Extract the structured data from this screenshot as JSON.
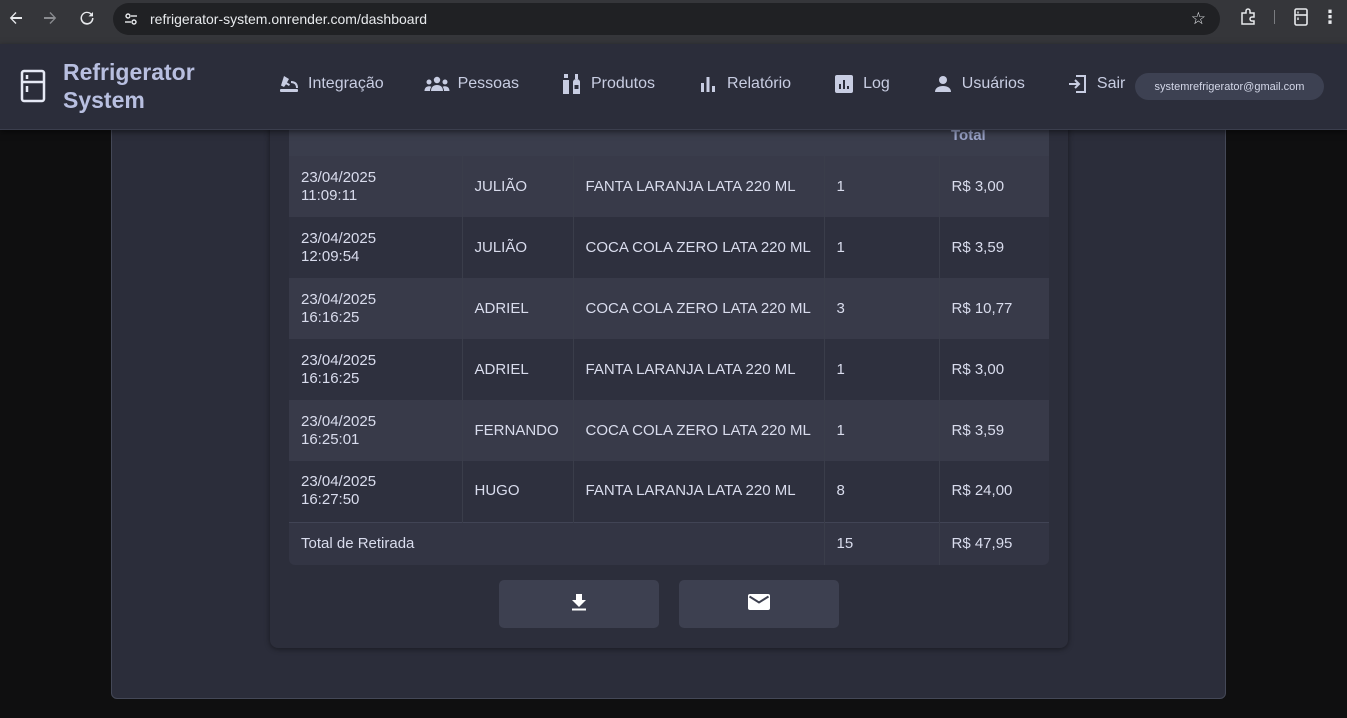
{
  "browser": {
    "url": "refrigerator-system.onrender.com/dashboard"
  },
  "app": {
    "title": "Refrigerator System",
    "user_email": "systemrefrigerator@gmail.com"
  },
  "nav": [
    {
      "label": "Integração",
      "icon": "integration-icon"
    },
    {
      "label": "Pessoas",
      "icon": "people-icon"
    },
    {
      "label": "Produtos",
      "icon": "bottles-icon"
    },
    {
      "label": "Relatório",
      "icon": "bar-chart-icon"
    },
    {
      "label": "Log",
      "icon": "analytics-icon"
    },
    {
      "label": "Usuários",
      "icon": "user-icon"
    },
    {
      "label": "Sair",
      "icon": "logout-icon"
    }
  ],
  "table": {
    "headers": [
      "",
      "",
      "",
      "",
      "Total"
    ],
    "rows": [
      {
        "date": "23/04/2025",
        "time": "11:09:11",
        "person": "JULIÃO",
        "product": "FANTA LARANJA LATA 220 ML",
        "qty": "1",
        "total": "R$ 3,00"
      },
      {
        "date": "23/04/2025",
        "time": "12:09:54",
        "person": "JULIÃO",
        "product": "COCA COLA ZERO LATA 220 ML",
        "qty": "1",
        "total": "R$ 3,59"
      },
      {
        "date": "23/04/2025",
        "time": "16:16:25",
        "person": "ADRIEL",
        "product": "COCA COLA ZERO LATA 220 ML",
        "qty": "3",
        "total": "R$ 10,77"
      },
      {
        "date": "23/04/2025",
        "time": "16:16:25",
        "person": "ADRIEL",
        "product": "FANTA LARANJA LATA 220 ML",
        "qty": "1",
        "total": "R$ 3,00"
      },
      {
        "date": "23/04/2025",
        "time": "16:25:01",
        "person": "FERNANDO",
        "product": "COCA COLA ZERO LATA 220 ML",
        "qty": "1",
        "total": "R$ 3,59"
      },
      {
        "date": "23/04/2025",
        "time": "16:27:50",
        "person": "HUGO",
        "product": "FANTA LARANJA LATA 220 ML",
        "qty": "8",
        "total": "R$ 24,00"
      }
    ],
    "footer": {
      "label": "Total de Retirada",
      "qty": "15",
      "total": "R$ 47,95"
    }
  },
  "actions": [
    {
      "icon": "download-icon"
    },
    {
      "icon": "email-icon"
    }
  ]
}
